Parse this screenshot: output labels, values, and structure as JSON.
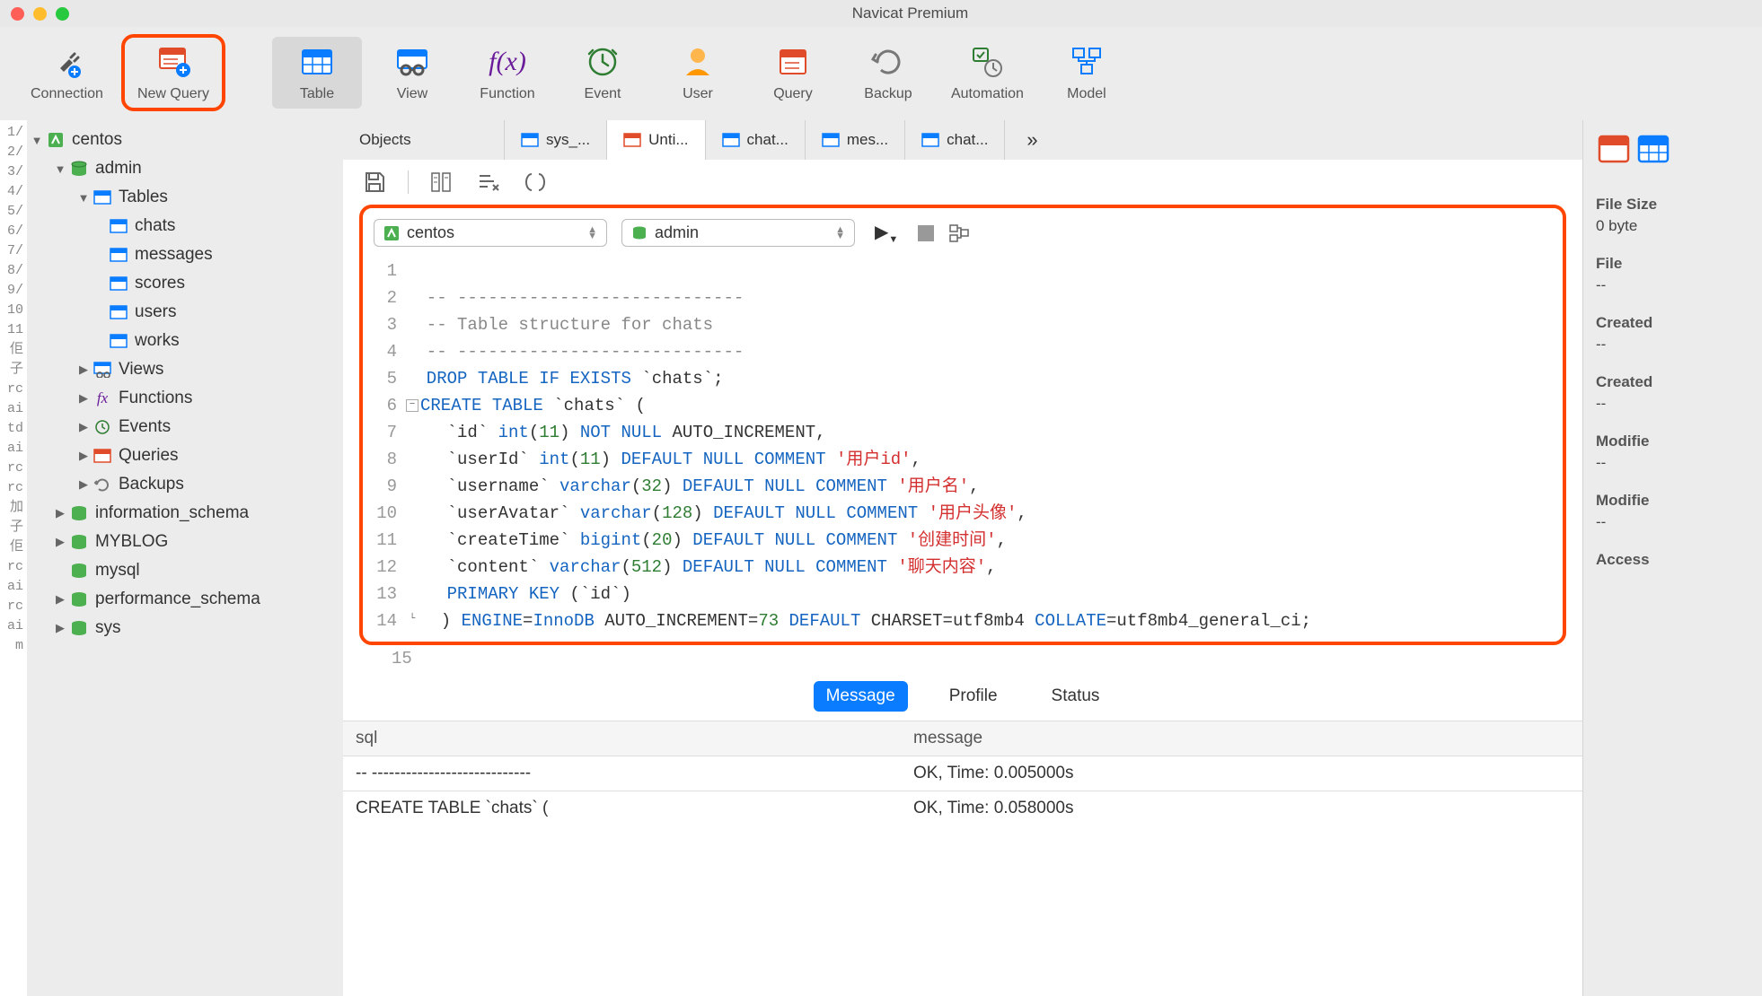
{
  "app": {
    "title": "Navicat Premium"
  },
  "toolbar": {
    "connection": "Connection",
    "new_query": "New Query",
    "table": "Table",
    "view": "View",
    "function": "Function",
    "event": "Event",
    "user": "User",
    "query": "Query",
    "backup": "Backup",
    "automation": "Automation",
    "model": "Model"
  },
  "sidebar": {
    "conn": "centos",
    "db_admin": "admin",
    "tables_label": "Tables",
    "tables": {
      "chats": "chats",
      "messages": "messages",
      "scores": "scores",
      "users": "users",
      "works": "works"
    },
    "views": "Views",
    "functions": "Functions",
    "events": "Events",
    "queries": "Queries",
    "backups": "Backups",
    "information_schema": "information_schema",
    "myblog": "MYBLOG",
    "mysql": "mysql",
    "performance_schema": "performance_schema",
    "sys": "sys"
  },
  "tabs": {
    "objects": "Objects",
    "sys": "sys_...",
    "unti": "Unti...",
    "chat1": "chat...",
    "mes": "mes...",
    "chat2": "chat..."
  },
  "dropdowns": {
    "connection": "centos",
    "database": "admin"
  },
  "code": {
    "l1": "",
    "l2": "  -- ----------------------------",
    "l3": "  -- Table structure for chats",
    "l4": "  -- ----------------------------",
    "l5a": "  DROP",
    "l5b": " TABLE",
    "l5c": " IF",
    "l5d": " EXISTS",
    "l5e": " `chats`;",
    "l6a": "CREATE",
    "l6b": " TABLE",
    "l6c": " `chats` (",
    "l7a": "    `id` ",
    "l7b": "int",
    "l7c": "(",
    "l7d": "11",
    "l7e": ")",
    "l7f": " NOT",
    "l7g": " NULL",
    "l7h": " AUTO_INCREMENT,",
    "l8a": "    `userId` ",
    "l8b": "int",
    "l8c": "(",
    "l8d": "11",
    "l8e": ")",
    "l8f": " DEFAULT",
    "l8g": " NULL",
    "l8h": " COMMENT ",
    "l8i": "'用户id'",
    "l8j": ",",
    "l9a": "    `username` ",
    "l9b": "varchar",
    "l9c": "(",
    "l9d": "32",
    "l9e": ")",
    "l9f": " DEFAULT",
    "l9g": " NULL",
    "l9h": " COMMENT ",
    "l9i": "'用户名'",
    "l9j": ",",
    "l10a": "    `userAvatar` ",
    "l10b": "varchar",
    "l10c": "(",
    "l10d": "128",
    "l10e": ")",
    "l10f": " DEFAULT",
    "l10g": " NULL",
    "l10h": " COMMENT ",
    "l10i": "'用户头像'",
    "l10j": ",",
    "l11a": "    `createTime` ",
    "l11b": "bigint",
    "l11c": "(",
    "l11d": "20",
    "l11e": ")",
    "l11f": " DEFAULT",
    "l11g": " NULL",
    "l11h": " COMMENT ",
    "l11i": "'创建时间'",
    "l11j": ",",
    "l12a": "    `content` ",
    "l12b": "varchar",
    "l12c": "(",
    "l12d": "512",
    "l12e": ")",
    "l12f": " DEFAULT",
    "l12g": " NULL",
    "l12h": " COMMENT ",
    "l12i": "'聊天内容'",
    "l12j": ",",
    "l13a": "    PRIMARY",
    "l13b": " KEY",
    "l13c": " (`id`)",
    "l14a": "  )",
    "l14b": " ENGINE",
    "l14c": "=",
    "l14d": "InnoDB",
    "l14e": " AUTO_INCREMENT=",
    "l14f": "73",
    "l14g": " DEFAULT",
    "l14h": " CHARSET=utf8mb4",
    "l14i": " COLLATE",
    "l14j": "=utf8mb4_general_ci;"
  },
  "result_tabs": {
    "message": "Message",
    "profile": "Profile",
    "status": "Status"
  },
  "result_headers": {
    "sql": "sql",
    "message": "message"
  },
  "result_rows": [
    {
      "sql": "-- ----------------------------",
      "message": "OK, Time: 0.005000s"
    },
    {
      "sql": "CREATE TABLE `chats` (",
      "message": "OK, Time: 0.058000s"
    }
  ],
  "right_panel": {
    "file_size": "File Size",
    "file_size_v": "0 byte",
    "file": "File",
    "file_v": "--",
    "created": "Created",
    "created_v": "--",
    "created2": "Created",
    "created2_v": "--",
    "modified": "Modifie",
    "modified_v": "--",
    "modified2": "Modifie",
    "modified2_v": "--",
    "access": "Access"
  }
}
